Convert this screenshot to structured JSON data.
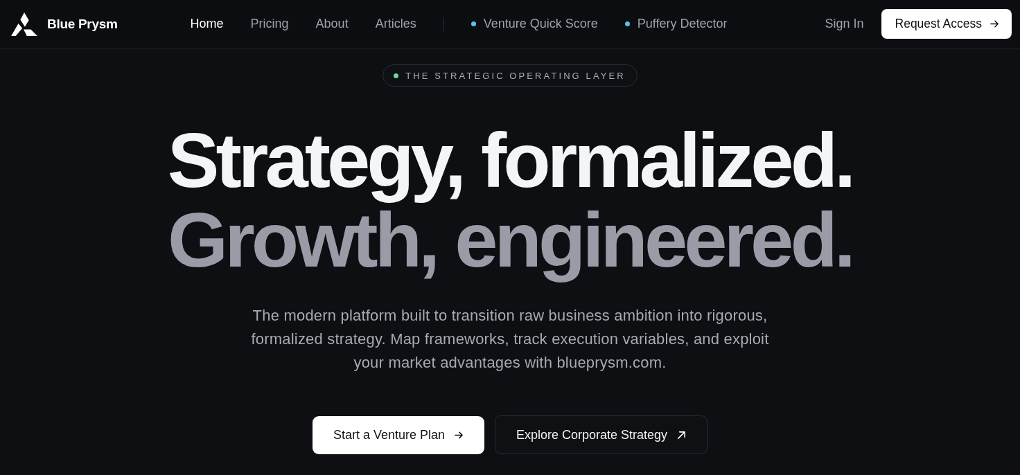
{
  "brand": {
    "name": "Blue Prysm"
  },
  "nav": {
    "links": [
      {
        "label": "Home",
        "selected": true
      },
      {
        "label": "Pricing",
        "selected": false
      },
      {
        "label": "About",
        "selected": false
      },
      {
        "label": "Articles",
        "selected": false
      }
    ],
    "tools": [
      {
        "label": "Venture Quick Score"
      },
      {
        "label": "Puffery Detector"
      }
    ]
  },
  "actions": {
    "sign_in": "Sign In",
    "request_access": "Request Access"
  },
  "hero": {
    "badge": "THE STRATEGIC OPERATING LAYER",
    "headline": [
      {
        "text": "Strategy, formalized.",
        "muted": false
      },
      {
        "text": "Growth, engineered.",
        "muted": true
      }
    ],
    "description": "The modern platform built to transition raw business ambition into rigorous, formalized strategy. Map frameworks, track execution variables, and exploit your market advantages with blueprysm.com.",
    "buttons": [
      {
        "label": "Start a Venture Plan",
        "kind": "primary"
      },
      {
        "label": "Explore Corporate Strategy",
        "kind": "secondary"
      }
    ]
  }
}
